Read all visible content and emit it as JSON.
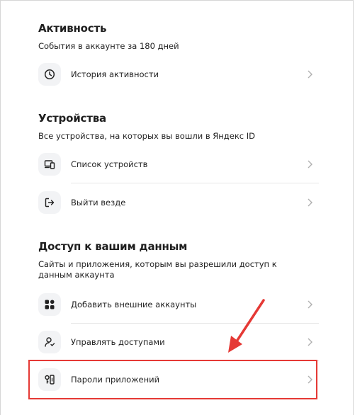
{
  "activity": {
    "title": "Активность",
    "subtitle": "События в аккаунте за 180 дней",
    "items": [
      {
        "label": "История активности",
        "icon": "clock-icon"
      }
    ]
  },
  "devices": {
    "title": "Устройства",
    "subtitle": "Все устройства, на которых вы вошли в Яндекс ID",
    "items": [
      {
        "label": "Список устройств",
        "icon": "devices-icon"
      },
      {
        "label": "Выйти везде",
        "icon": "logout-icon"
      }
    ]
  },
  "data_access": {
    "title": "Доступ к вашим данным",
    "subtitle": "Сайты и приложения, которым вы разрешили доступ к данным аккаунта",
    "items": [
      {
        "label": "Добавить внешние аккаунты",
        "icon": "external-accounts-icon"
      },
      {
        "label": "Управлять доступами",
        "icon": "user-access-icon"
      },
      {
        "label": "Пароли приложений",
        "icon": "app-passwords-icon"
      }
    ]
  },
  "colors": {
    "highlight": "#e53935",
    "icon_bg": "#f2f3f5"
  }
}
